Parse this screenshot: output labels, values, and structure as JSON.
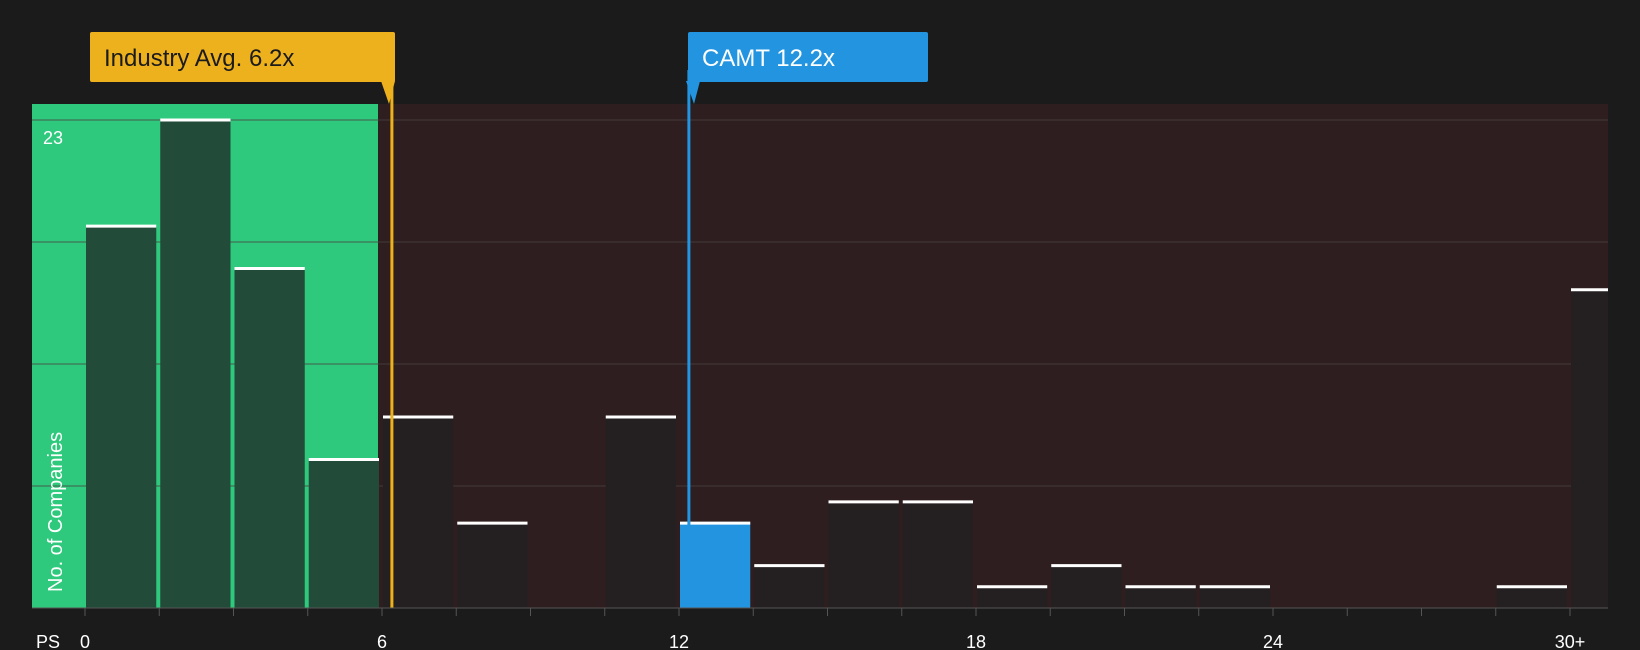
{
  "chart_data": {
    "type": "bar",
    "metric_label": "PS",
    "ylabel": "No. of Companies",
    "y_max_label": "23",
    "ylim": [
      0,
      23
    ],
    "x_ticks": [
      "0",
      "6",
      "12",
      "18",
      "24",
      "30+"
    ],
    "bins": [
      {
        "x": 0.0,
        "value": 18
      },
      {
        "x": 1.5,
        "value": 23
      },
      {
        "x": 3.0,
        "value": 16
      },
      {
        "x": 4.5,
        "value": 7
      },
      {
        "x": 6.0,
        "value": 9
      },
      {
        "x": 7.5,
        "value": 4
      },
      {
        "x": 9.0,
        "value": 0
      },
      {
        "x": 10.5,
        "value": 9
      },
      {
        "x": 12.0,
        "value": 4
      },
      {
        "x": 13.5,
        "value": 2
      },
      {
        "x": 15.0,
        "value": 5
      },
      {
        "x": 16.5,
        "value": 5
      },
      {
        "x": 18.0,
        "value": 1
      },
      {
        "x": 19.5,
        "value": 2
      },
      {
        "x": 21.0,
        "value": 1
      },
      {
        "x": 22.5,
        "value": 1
      },
      {
        "x": 24.0,
        "value": 0
      },
      {
        "x": 25.5,
        "value": 0
      },
      {
        "x": 27.0,
        "value": 0
      },
      {
        "x": 28.5,
        "value": 1
      },
      {
        "x": 30.0,
        "value": 15
      }
    ],
    "industry_avg": {
      "label": "Industry Avg. 6.2x",
      "value": 6.2
    },
    "company": {
      "label": "CAMT 12.2x",
      "value": 12.2
    }
  },
  "colors": {
    "background": "#1b1b1b",
    "fair_zone": "#2ec97c",
    "over_zone": "#2e1e1f",
    "bar_in_fair": "#234b39",
    "bar_default": "#241f20",
    "bar_company": "#2394e0",
    "industry_callout": "#eeb11e",
    "company_callout": "#2394e0",
    "bar_cap": "#ffffff",
    "grid": "#4a4040"
  }
}
